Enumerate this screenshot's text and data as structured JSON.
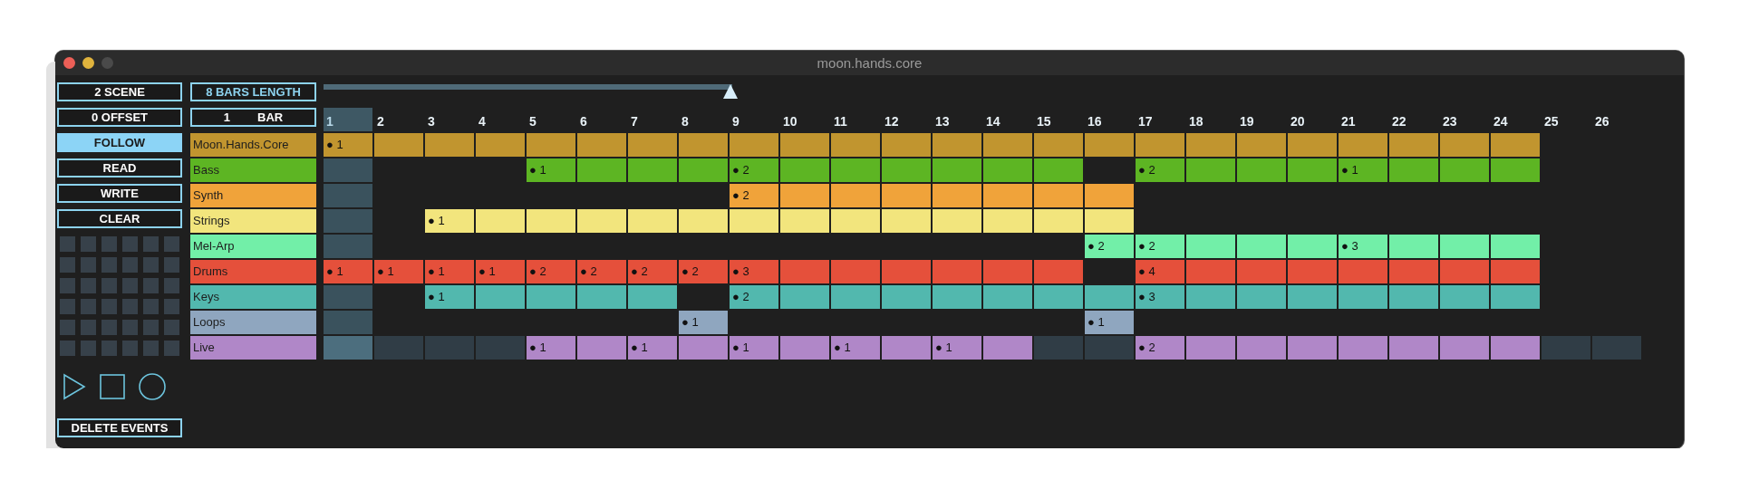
{
  "window": {
    "title": "moon.hands.core",
    "controls": [
      {
        "kind": "close",
        "disabled": false
      },
      {
        "kind": "minimize",
        "disabled": false
      },
      {
        "kind": "zoom",
        "disabled": true
      }
    ]
  },
  "left_buttons": [
    {
      "label": "2 SCENE",
      "on": false
    },
    {
      "label": "0 OFFSET",
      "on": false
    },
    {
      "label": "FOLLOW",
      "on": true
    },
    {
      "label": "READ",
      "on": false
    },
    {
      "label": "WRITE",
      "on": false
    },
    {
      "label": "CLEAR",
      "on": false
    }
  ],
  "length_button": {
    "label": "8 BARS LENGTH"
  },
  "bar_field": {
    "value": "1",
    "unit": "BAR"
  },
  "loop_slider": {
    "level": 0.31
  },
  "pads": [
    {
      "on": false
    },
    {
      "on": false
    },
    {
      "on": false
    },
    {
      "on": false
    },
    {
      "on": false
    },
    {
      "on": false
    },
    {
      "on": false
    },
    {
      "on": false
    },
    {
      "on": false
    },
    {
      "on": false
    },
    {
      "on": false
    },
    {
      "on": false
    },
    {
      "on": false
    },
    {
      "on": false
    },
    {
      "on": false
    },
    {
      "on": false
    },
    {
      "on": false
    },
    {
      "on": false
    },
    {
      "on": false
    },
    {
      "on": false
    },
    {
      "on": false
    },
    {
      "on": false
    },
    {
      "on": false
    },
    {
      "on": false
    },
    {
      "on": false
    },
    {
      "on": false
    },
    {
      "on": false
    },
    {
      "on": false
    },
    {
      "on": false
    },
    {
      "on": false
    },
    {
      "on": false
    },
    {
      "on": false
    },
    {
      "on": false
    },
    {
      "on": false
    },
    {
      "on": false
    },
    {
      "on": false
    }
  ],
  "transport": [
    {
      "kind": "play"
    },
    {
      "kind": "stop"
    },
    {
      "kind": "record"
    }
  ],
  "delete_button": {
    "label": "DELETE EVENTS"
  },
  "bars": [
    {
      "label": "1",
      "selected": true
    },
    {
      "label": "2",
      "selected": false
    },
    {
      "label": "3",
      "selected": false
    },
    {
      "label": "4",
      "selected": false
    },
    {
      "label": "5",
      "selected": false
    },
    {
      "label": "6",
      "selected": false
    },
    {
      "label": "7",
      "selected": false
    },
    {
      "label": "8",
      "selected": false
    },
    {
      "label": "9",
      "selected": false
    },
    {
      "label": "10",
      "selected": false
    },
    {
      "label": "11",
      "selected": false
    },
    {
      "label": "12",
      "selected": false
    },
    {
      "label": "13",
      "selected": false
    },
    {
      "label": "14",
      "selected": false
    },
    {
      "label": "15",
      "selected": false
    },
    {
      "label": "16",
      "selected": false
    },
    {
      "label": "17",
      "selected": false
    },
    {
      "label": "18",
      "selected": false
    },
    {
      "label": "19",
      "selected": false
    },
    {
      "label": "20",
      "selected": false
    },
    {
      "label": "21",
      "selected": false
    },
    {
      "label": "22",
      "selected": false
    },
    {
      "label": "23",
      "selected": false
    },
    {
      "label": "24",
      "selected": false
    },
    {
      "label": "25",
      "selected": false
    },
    {
      "label": "26",
      "selected": false
    }
  ],
  "tracks": [
    {
      "name": "Moon.Hands.Core",
      "color": "#c1952f",
      "cells": [
        {
          "kind": "clip",
          "label": "● 1"
        },
        {
          "kind": "clip"
        },
        {
          "kind": "clip"
        },
        {
          "kind": "clip"
        },
        {
          "kind": "clip"
        },
        {
          "kind": "clip"
        },
        {
          "kind": "clip"
        },
        {
          "kind": "clip"
        },
        {
          "kind": "clip"
        },
        {
          "kind": "clip"
        },
        {
          "kind": "clip"
        },
        {
          "kind": "clip"
        },
        {
          "kind": "clip"
        },
        {
          "kind": "clip"
        },
        {
          "kind": "clip"
        },
        {
          "kind": "clip"
        },
        {
          "kind": "clip"
        },
        {
          "kind": "clip"
        },
        {
          "kind": "clip"
        },
        {
          "kind": "clip"
        },
        {
          "kind": "clip"
        },
        {
          "kind": "clip"
        },
        {
          "kind": "clip"
        },
        {
          "kind": "clip"
        },
        {
          "kind": "empty"
        },
        {
          "kind": "empty"
        }
      ]
    },
    {
      "name": "Bass",
      "color": "#5db523",
      "cells": [
        {
          "kind": "empty"
        },
        {
          "kind": "empty"
        },
        {
          "kind": "empty"
        },
        {
          "kind": "empty"
        },
        {
          "kind": "clip",
          "label": "● 1"
        },
        {
          "kind": "clip"
        },
        {
          "kind": "clip"
        },
        {
          "kind": "clip"
        },
        {
          "kind": "clip",
          "label": "● 2"
        },
        {
          "kind": "clip"
        },
        {
          "kind": "clip"
        },
        {
          "kind": "clip"
        },
        {
          "kind": "clip"
        },
        {
          "kind": "clip"
        },
        {
          "kind": "clip"
        },
        {
          "kind": "empty"
        },
        {
          "kind": "clip",
          "label": "● 2"
        },
        {
          "kind": "clip"
        },
        {
          "kind": "clip"
        },
        {
          "kind": "clip"
        },
        {
          "kind": "clip",
          "label": "● 1"
        },
        {
          "kind": "clip"
        },
        {
          "kind": "clip"
        },
        {
          "kind": "clip"
        },
        {
          "kind": "empty"
        },
        {
          "kind": "empty"
        }
      ]
    },
    {
      "name": "Synth",
      "color": "#f0a33a",
      "cells": [
        {
          "kind": "empty"
        },
        {
          "kind": "empty"
        },
        {
          "kind": "empty"
        },
        {
          "kind": "empty"
        },
        {
          "kind": "empty"
        },
        {
          "kind": "empty"
        },
        {
          "kind": "empty"
        },
        {
          "kind": "empty"
        },
        {
          "kind": "clip",
          "label": "● 2"
        },
        {
          "kind": "clip"
        },
        {
          "kind": "clip"
        },
        {
          "kind": "clip"
        },
        {
          "kind": "clip"
        },
        {
          "kind": "clip"
        },
        {
          "kind": "clip"
        },
        {
          "kind": "clip"
        },
        {
          "kind": "empty"
        },
        {
          "kind": "empty"
        },
        {
          "kind": "empty"
        },
        {
          "kind": "empty"
        },
        {
          "kind": "empty"
        },
        {
          "kind": "empty"
        },
        {
          "kind": "empty"
        },
        {
          "kind": "empty"
        },
        {
          "kind": "empty"
        },
        {
          "kind": "empty"
        }
      ]
    },
    {
      "name": "Strings",
      "color": "#f2e57d",
      "cells": [
        {
          "kind": "empty"
        },
        {
          "kind": "empty"
        },
        {
          "kind": "clip",
          "label": "● 1"
        },
        {
          "kind": "clip"
        },
        {
          "kind": "clip"
        },
        {
          "kind": "clip"
        },
        {
          "kind": "clip"
        },
        {
          "kind": "clip"
        },
        {
          "kind": "clip"
        },
        {
          "kind": "clip"
        },
        {
          "kind": "clip"
        },
        {
          "kind": "clip"
        },
        {
          "kind": "clip"
        },
        {
          "kind": "clip"
        },
        {
          "kind": "clip"
        },
        {
          "kind": "clip"
        },
        {
          "kind": "empty"
        },
        {
          "kind": "empty"
        },
        {
          "kind": "empty"
        },
        {
          "kind": "empty"
        },
        {
          "kind": "empty"
        },
        {
          "kind": "empty"
        },
        {
          "kind": "empty"
        },
        {
          "kind": "empty"
        },
        {
          "kind": "empty"
        },
        {
          "kind": "empty"
        }
      ]
    },
    {
      "name": "Mel-Arp",
      "color": "#72efa8",
      "cells": [
        {
          "kind": "empty"
        },
        {
          "kind": "empty"
        },
        {
          "kind": "empty"
        },
        {
          "kind": "empty"
        },
        {
          "kind": "empty"
        },
        {
          "kind": "empty"
        },
        {
          "kind": "empty"
        },
        {
          "kind": "empty"
        },
        {
          "kind": "empty"
        },
        {
          "kind": "empty"
        },
        {
          "kind": "empty"
        },
        {
          "kind": "empty"
        },
        {
          "kind": "empty"
        },
        {
          "kind": "empty"
        },
        {
          "kind": "empty"
        },
        {
          "kind": "clip",
          "label": "● 2"
        },
        {
          "kind": "clip",
          "label": "● 2"
        },
        {
          "kind": "clip"
        },
        {
          "kind": "clip"
        },
        {
          "kind": "clip"
        },
        {
          "kind": "clip",
          "label": "● 3"
        },
        {
          "kind": "clip"
        },
        {
          "kind": "clip"
        },
        {
          "kind": "clip"
        },
        {
          "kind": "empty"
        },
        {
          "kind": "empty"
        }
      ]
    },
    {
      "name": "Drums",
      "color": "#e5503b",
      "cells": [
        {
          "kind": "clip",
          "label": "● 1"
        },
        {
          "kind": "clip",
          "label": "● 1"
        },
        {
          "kind": "clip",
          "label": "● 1"
        },
        {
          "kind": "clip",
          "label": "● 1"
        },
        {
          "kind": "clip",
          "label": "● 2"
        },
        {
          "kind": "clip",
          "label": "● 2"
        },
        {
          "kind": "clip",
          "label": "● 2"
        },
        {
          "kind": "clip",
          "label": "● 2"
        },
        {
          "kind": "clip",
          "label": "● 3"
        },
        {
          "kind": "clip"
        },
        {
          "kind": "clip"
        },
        {
          "kind": "clip"
        },
        {
          "kind": "clip"
        },
        {
          "kind": "clip"
        },
        {
          "kind": "clip"
        },
        {
          "kind": "empty"
        },
        {
          "kind": "clip",
          "label": "● 4"
        },
        {
          "kind": "clip"
        },
        {
          "kind": "clip"
        },
        {
          "kind": "clip"
        },
        {
          "kind": "clip"
        },
        {
          "kind": "clip"
        },
        {
          "kind": "clip"
        },
        {
          "kind": "clip"
        },
        {
          "kind": "empty"
        },
        {
          "kind": "empty"
        }
      ]
    },
    {
      "name": "Keys",
      "color": "#52b8ae",
      "cells": [
        {
          "kind": "empty"
        },
        {
          "kind": "empty"
        },
        {
          "kind": "clip",
          "label": "● 1"
        },
        {
          "kind": "clip"
        },
        {
          "kind": "clip"
        },
        {
          "kind": "clip"
        },
        {
          "kind": "clip"
        },
        {
          "kind": "empty"
        },
        {
          "kind": "clip",
          "label": "● 2"
        },
        {
          "kind": "clip"
        },
        {
          "kind": "clip"
        },
        {
          "kind": "clip"
        },
        {
          "kind": "clip"
        },
        {
          "kind": "clip"
        },
        {
          "kind": "clip"
        },
        {
          "kind": "clip"
        },
        {
          "kind": "clip",
          "label": "● 3"
        },
        {
          "kind": "clip"
        },
        {
          "kind": "clip"
        },
        {
          "kind": "clip"
        },
        {
          "kind": "clip"
        },
        {
          "kind": "clip"
        },
        {
          "kind": "clip"
        },
        {
          "kind": "clip"
        },
        {
          "kind": "empty"
        },
        {
          "kind": "empty"
        }
      ]
    },
    {
      "name": "Loops",
      "color": "#8fa6bf",
      "cells": [
        {
          "kind": "empty"
        },
        {
          "kind": "empty"
        },
        {
          "kind": "empty"
        },
        {
          "kind": "empty"
        },
        {
          "kind": "empty"
        },
        {
          "kind": "empty"
        },
        {
          "kind": "empty"
        },
        {
          "kind": "clip",
          "label": "● 1"
        },
        {
          "kind": "empty"
        },
        {
          "kind": "empty"
        },
        {
          "kind": "empty"
        },
        {
          "kind": "empty"
        },
        {
          "kind": "empty"
        },
        {
          "kind": "empty"
        },
        {
          "kind": "empty"
        },
        {
          "kind": "clip",
          "label": "● 1"
        },
        {
          "kind": "empty"
        },
        {
          "kind": "empty"
        },
        {
          "kind": "empty"
        },
        {
          "kind": "empty"
        },
        {
          "kind": "empty"
        },
        {
          "kind": "empty"
        },
        {
          "kind": "empty"
        },
        {
          "kind": "empty"
        },
        {
          "kind": "empty"
        },
        {
          "kind": "empty"
        }
      ]
    },
    {
      "name": "Live",
      "color": "#b087c8",
      "cells": [
        {
          "kind": "slot"
        },
        {
          "kind": "slot"
        },
        {
          "kind": "slot"
        },
        {
          "kind": "slot"
        },
        {
          "kind": "clip",
          "label": "● 1"
        },
        {
          "kind": "clip"
        },
        {
          "kind": "clip",
          "label": "● 1"
        },
        {
          "kind": "clip"
        },
        {
          "kind": "clip",
          "label": "● 1"
        },
        {
          "kind": "clip"
        },
        {
          "kind": "clip",
          "label": "● 1"
        },
        {
          "kind": "clip"
        },
        {
          "kind": "clip",
          "label": "● 1"
        },
        {
          "kind": "clip"
        },
        {
          "kind": "slot"
        },
        {
          "kind": "slot"
        },
        {
          "kind": "clip",
          "label": "● 2"
        },
        {
          "kind": "clip"
        },
        {
          "kind": "clip"
        },
        {
          "kind": "clip"
        },
        {
          "kind": "clip"
        },
        {
          "kind": "clip"
        },
        {
          "kind": "clip"
        },
        {
          "kind": "clip"
        },
        {
          "kind": "slot"
        },
        {
          "kind": "slot"
        }
      ]
    }
  ]
}
